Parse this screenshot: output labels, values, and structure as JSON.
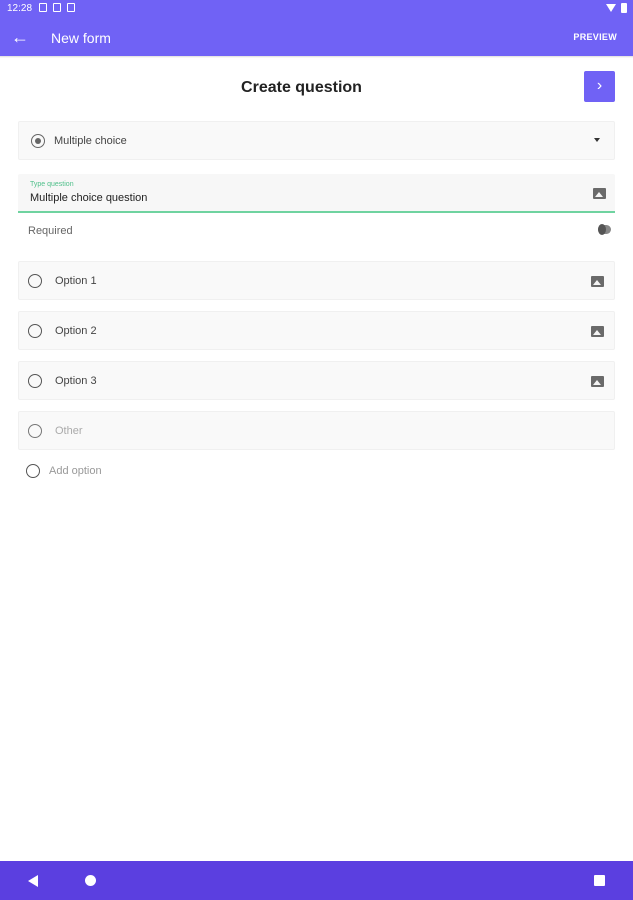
{
  "status_bar": {
    "time": "12:28"
  },
  "app_bar": {
    "title": "New form",
    "preview_label": "PREVIEW"
  },
  "page": {
    "title": "Create question",
    "next_glyph": "›"
  },
  "question_type": {
    "selected": "Multiple choice"
  },
  "question": {
    "label": "Type question",
    "value": "Multiple choice question"
  },
  "required": {
    "label": "Required",
    "on": false
  },
  "options": [
    {
      "label": "Option 1"
    },
    {
      "label": "Option 2"
    },
    {
      "label": "Option 3"
    }
  ],
  "other": {
    "label": "Other"
  },
  "add_option": {
    "label": "Add option"
  },
  "colors": {
    "primary": "#7062f5",
    "nav_bar": "#5b3fe0",
    "field_accent": "#6fd3a0"
  },
  "icons": {
    "back": "arrow-left-icon",
    "next": "chevron-right-icon",
    "dropdown": "caret-down-icon",
    "image": "image-icon"
  }
}
